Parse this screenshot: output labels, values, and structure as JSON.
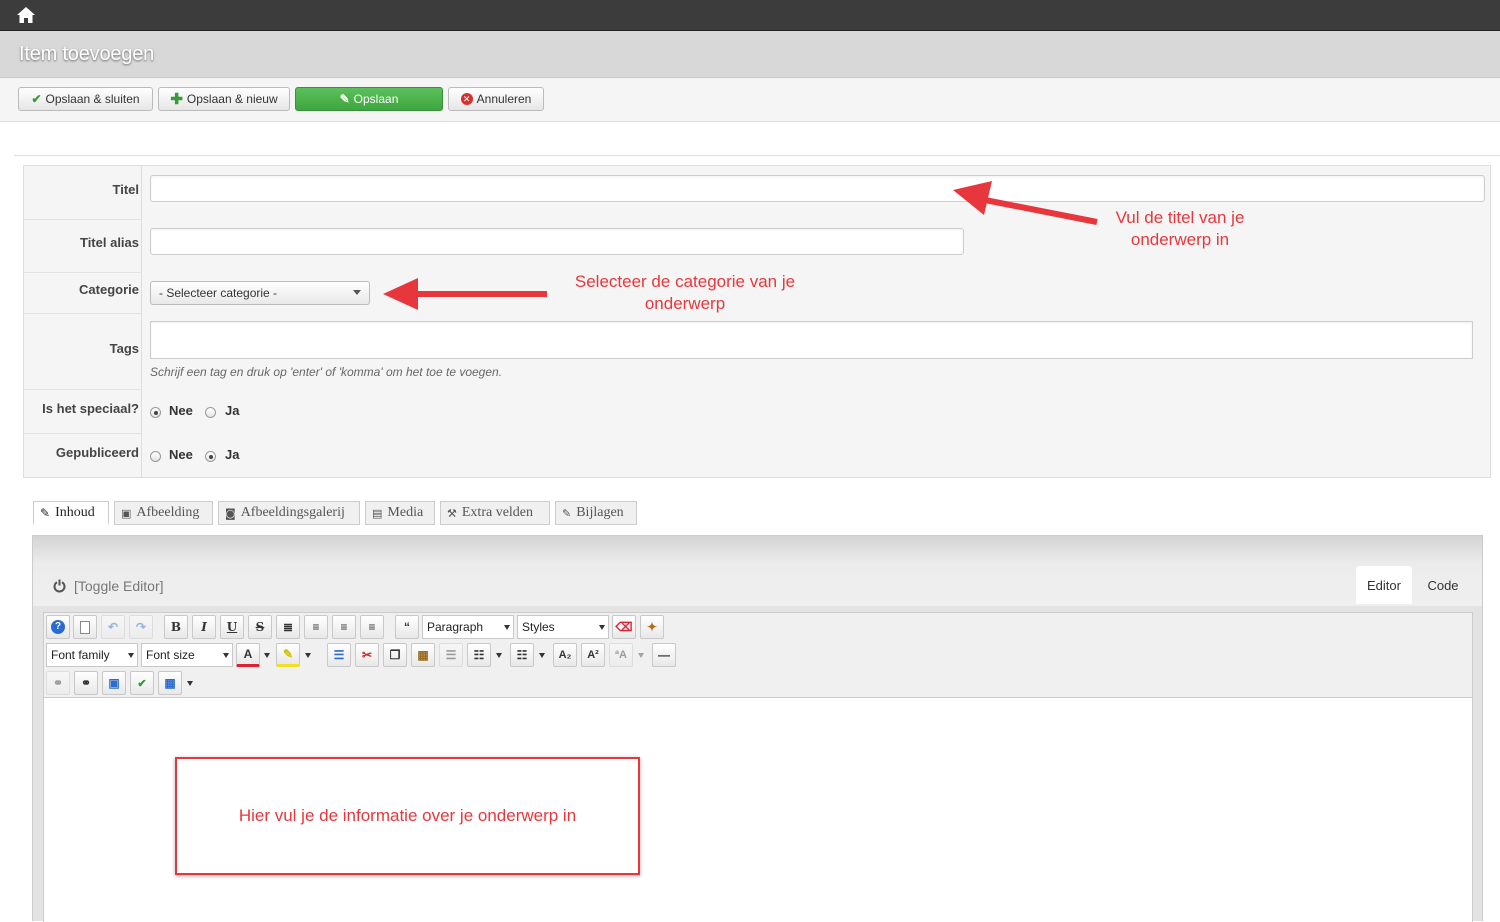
{
  "header": {
    "home_icon": "home-icon"
  },
  "page": {
    "title": "Item toevoegen"
  },
  "toolbar": {
    "save_close": "Opslaan & sluiten",
    "save_new": "Opslaan & nieuw",
    "save": "Opslaan",
    "cancel": "Annuleren"
  },
  "form": {
    "title_label": "Titel",
    "title_value": "",
    "alias_label": "Titel alias",
    "alias_value": "",
    "category_label": "Categorie",
    "category_value": "- Selecteer categorie -",
    "tags_label": "Tags",
    "tags_help": "Schrijf een tag en druk op 'enter' of 'komma' om het toe te voegen.",
    "special_label": "Is het speciaal?",
    "special_selected": "Nee",
    "published_label": "Gepubliceerd",
    "published_selected": "Ja",
    "no_label": "Nee",
    "yes_label": "Ja"
  },
  "annotations": {
    "title_note_1": "Vul de titel van je",
    "title_note_2": "onderwerp in",
    "category_note_1": "Selecteer de categorie van je",
    "category_note_2": "onderwerp",
    "content_note": "Hier vul je de informatie over je onderwerp in",
    "color": "#e8373c"
  },
  "tabs": [
    "Inhoud",
    "Afbeelding",
    "Afbeeldingsgalerij",
    "Media",
    "Extra velden",
    "Bijlagen"
  ],
  "editor": {
    "toggle": "[Toggle Editor]",
    "mode_editor": "Editor",
    "mode_code": "Code",
    "format_select": "Paragraph",
    "styles_select": "Styles",
    "font_family": "Font family",
    "font_size": "Font size"
  }
}
